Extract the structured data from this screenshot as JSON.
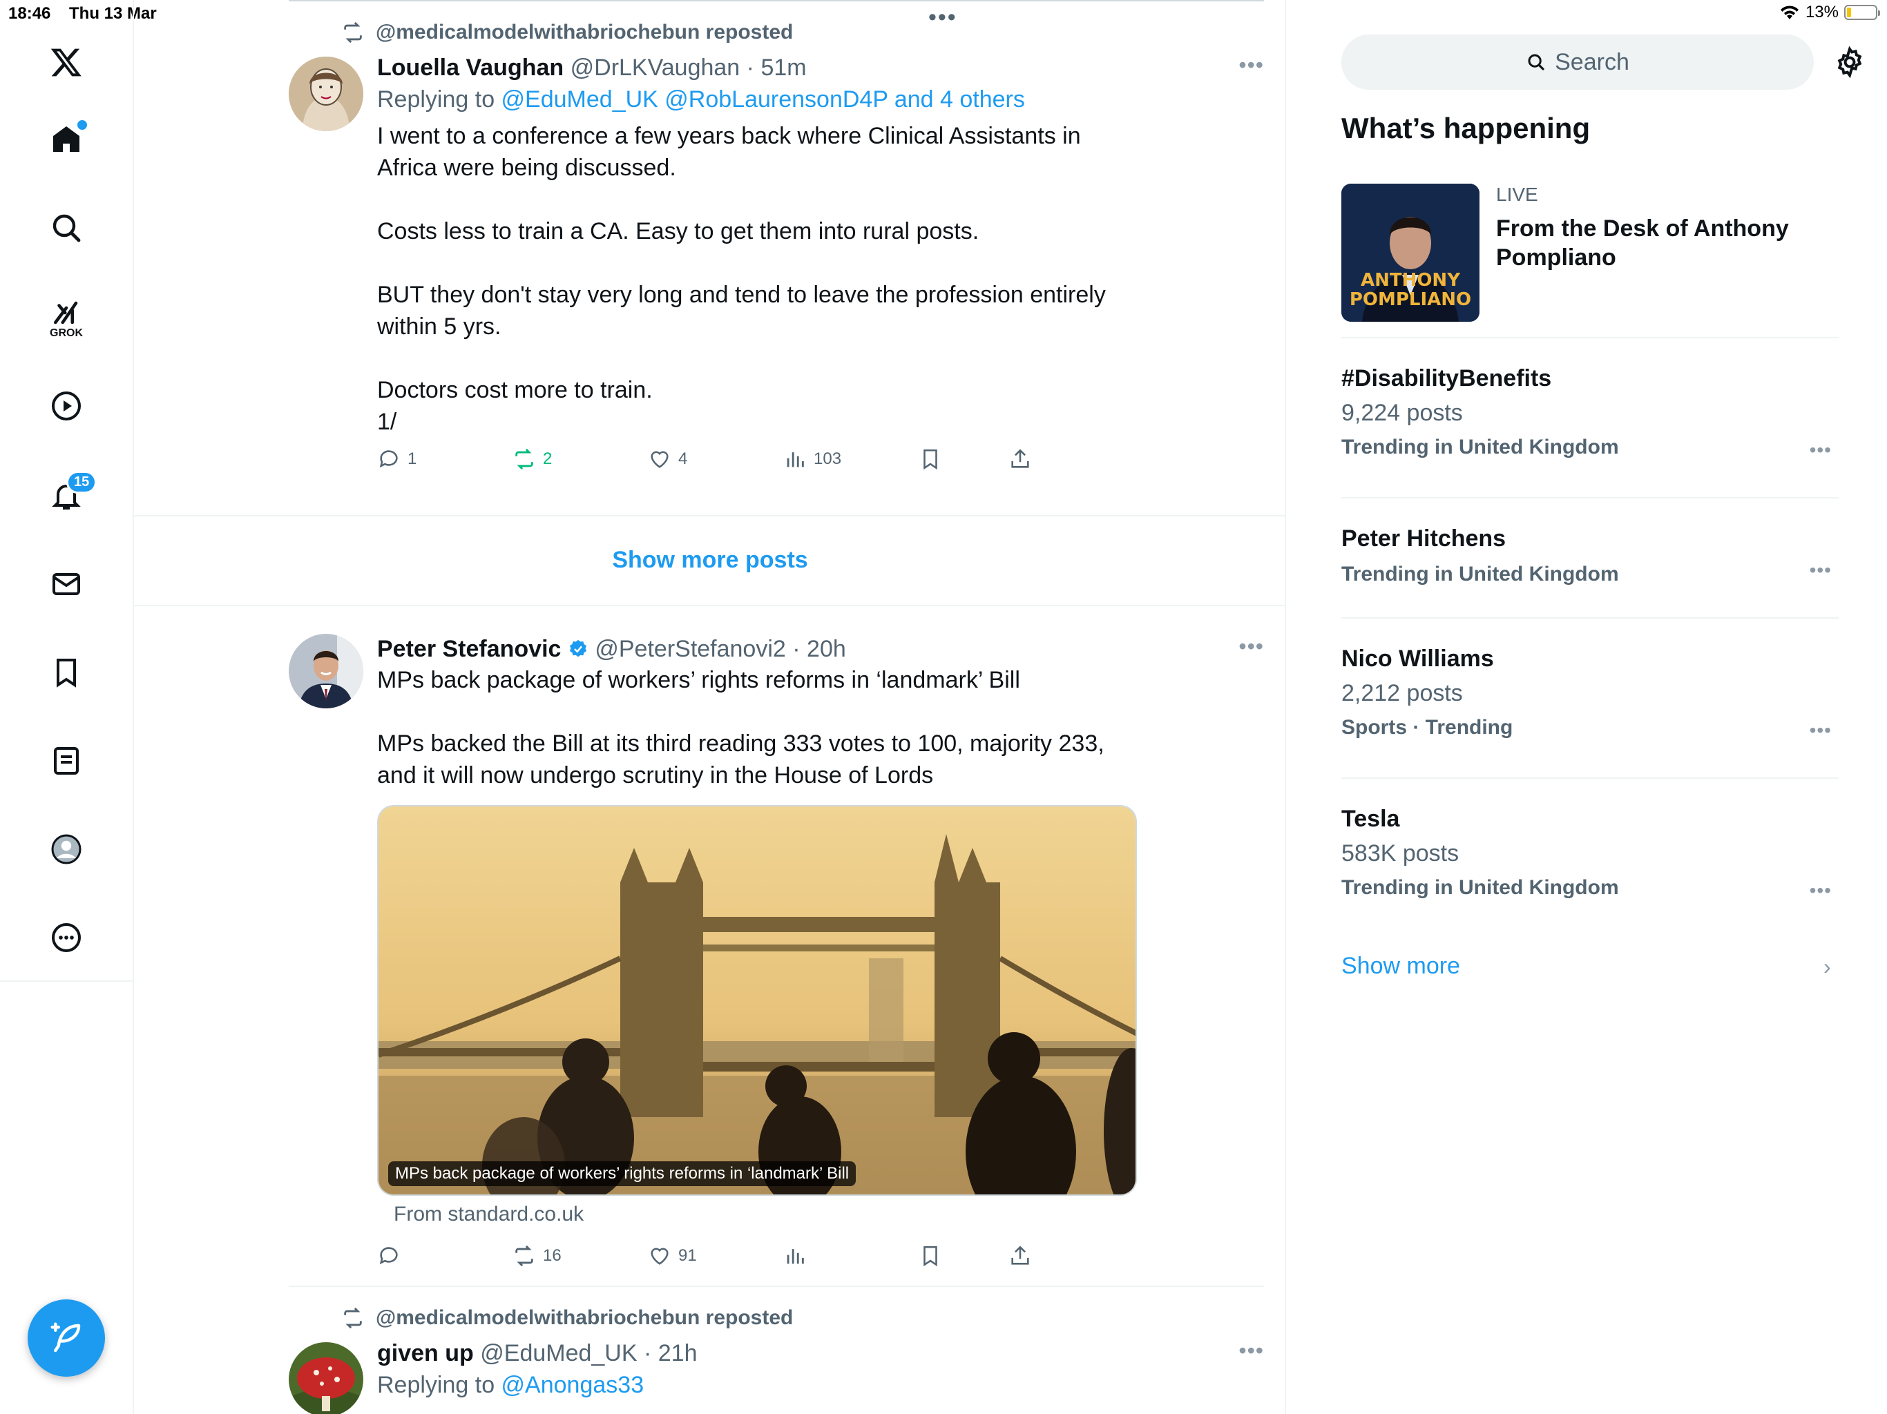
{
  "status": {
    "time": "18:46",
    "date": "Thu 13 Mar",
    "battery": "13%"
  },
  "nav": {
    "notifications_badge": "15",
    "grok_label": "GROK"
  },
  "posts": [
    {
      "repost_by": "@medicalmodelwithabriochebun reposted",
      "name": "Louella Vaughan",
      "handle": "@DrLKVaughan",
      "time": "· 51m",
      "replying_prefix": "Replying to ",
      "replying_to": "@EduMed_UK @RobLaurensonD4P and 4 others",
      "text": "I went to a conference a few years back where Clinical Assistants in\nAfrica were being discussed.\n\nCosts less to train a CA. Easy to get them into rural posts.\n\nBUT they don't stay very long and tend to leave the profession entirely\nwithin 5 yrs.\n\nDoctors cost more to train.\n1/",
      "replies": "1",
      "reposts": "2",
      "likes": "4",
      "views": "103"
    },
    {
      "name": "Peter Stefanovic",
      "handle": "@PeterStefanovi2",
      "time": "· 20h",
      "text": "MPs back package of workers’ rights reforms in ‘landmark’ Bill\n\nMPs backed the Bill at its third reading 333 votes to 100, majority 233,\nand it will now undergo scrutiny in the House of Lords",
      "card_caption": "MPs back package of workers’ rights reforms in ‘landmark’ Bill",
      "card_source": "From standard.co.uk",
      "replies": "",
      "reposts": "16",
      "likes": "91",
      "views": ""
    },
    {
      "repost_by": "@medicalmodelwithabriochebun reposted",
      "name": "given up",
      "handle": "@EduMed_UK",
      "time": "· 21h",
      "replying_prefix": "Replying to ",
      "replying_to": "@Anongas33"
    }
  ],
  "feed": {
    "show_more_posts": "Show more posts"
  },
  "sidebar": {
    "search_placeholder": "Search",
    "heading": "What’s happening",
    "live_label": "LIVE",
    "live_title": "From the Desk of Anthony Pompliano",
    "live_thumb_text_1": "ANTHONY",
    "live_thumb_text_2": "POMPLIANO",
    "trends": [
      {
        "name": "#DisabilityBenefits",
        "count": "9,224 posts",
        "meta": "Trending in United Kingdom"
      },
      {
        "name": "Peter Hitchens",
        "count": "",
        "meta": "Trending in United Kingdom"
      },
      {
        "name": "Nico Williams",
        "count": "2,212 posts",
        "meta": "Sports · Trending"
      },
      {
        "name": "Tesla",
        "count": "583K posts",
        "meta": "Trending in United Kingdom"
      }
    ],
    "show_more": "Show more"
  },
  "colors": {
    "accent": "#1d9bf0",
    "repost_green": "#00ba7c",
    "muted": "#536471"
  }
}
